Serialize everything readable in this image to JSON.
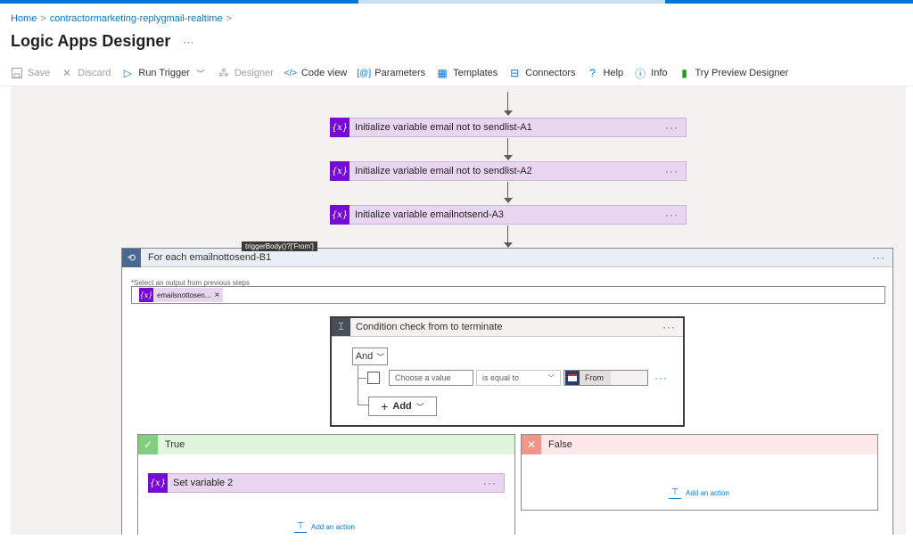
{
  "breadcrumb": {
    "home": "Home",
    "sep": ">",
    "item": "contractormarketing-replygmail-realtime"
  },
  "page": {
    "title": "Logic Apps Designer",
    "more": "···"
  },
  "toolbar": {
    "save": "Save",
    "discard": "Discard",
    "run_trigger": "Run Trigger",
    "designer": "Designer",
    "code_view": "Code view",
    "parameters": "Parameters",
    "templates": "Templates",
    "connectors": "Connectors",
    "help": "Help",
    "info": "Info",
    "try_preview": "Try Preview Designer"
  },
  "actions": [
    {
      "label": "Initialize variable email not to sendlist-A1"
    },
    {
      "label": "Initialize variable email not to sendlist-A2"
    },
    {
      "label": "Initialize variable emailnotsend-A3"
    }
  ],
  "foreach": {
    "label": "For each emailnottosend-B1",
    "tooltip": "triggerBody()?['From']",
    "select_label": "Select an output from previous steps",
    "required_mark": "*",
    "token": "emailsnottosen...",
    "token_remove": "×"
  },
  "condition": {
    "label": "Condition check from to terminate",
    "and": "And",
    "placeholder": "Choose a value",
    "operator": "is equal to",
    "from_token": "From",
    "add": "Add",
    "row_more": "···"
  },
  "branches": {
    "true_label": "True",
    "false_label": "False",
    "set_variable": "Set variable 2",
    "add_action": "Add an action"
  },
  "icons": {
    "var": "{x}",
    "more": "···"
  },
  "colors": {
    "accent": "#0078d4",
    "variable": "#770bd6",
    "variable_bg": "#e8d5f0",
    "true_bg": "#dff6dd",
    "false_bg": "#fde7e9"
  }
}
